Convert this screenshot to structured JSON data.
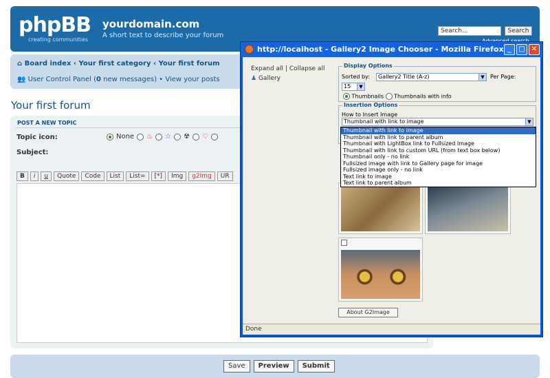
{
  "header": {
    "logo": "phpBB",
    "logo_tag": "creating   communities",
    "site_title": "yourdomain.com",
    "site_desc": "A short text to describe your forum",
    "search_placeholder": "Search…",
    "search_button": "Search",
    "advanced_search": "Advanced search"
  },
  "nav": {
    "board_index": "Board index",
    "category": "Your first category",
    "forum": "Your first forum",
    "ucp": "User Control Panel (",
    "ucp_count": "0",
    "ucp_rest": " new messages)",
    "view_posts": "View your posts"
  },
  "forum_title": "Your first forum",
  "post": {
    "heading": "POST A NEW TOPIC",
    "topic_icon_label": "Topic icon:",
    "none_label": "None",
    "subject_label": "Subject:",
    "toolbar": [
      "B",
      "i",
      "u",
      "Quote",
      "Code",
      "List",
      "List=",
      "[*]",
      "Img",
      "g2Img",
      "UR"
    ],
    "buttons": [
      "Save",
      "Preview",
      "Submit"
    ]
  },
  "firefox": {
    "title": "http://localhost - Gallery2 Image Chooser - Mozilla Firefox",
    "status": "Done",
    "expand_all": "Expand all",
    "collapse_all": "Collapse all",
    "gallery": "Gallery",
    "display_options": "Display Options",
    "sorted_by_label": "Sorted by:",
    "sorted_by_value": "Gallery2 Title (A-z)",
    "per_page_label": "Per Page:",
    "per_page_value": "15",
    "view_thumbnails": "Thumbnails",
    "view_thumbnails_info": "Thumbnails with info",
    "insertion_options": "Insertion Options",
    "how_to_insert": "How to Insert Image",
    "insert_value": "Thumbnail with link to image",
    "insert_options": [
      "Thumbnail with link to image",
      "Thumbnail with link to parent album",
      "Thumbnail with LightBox link to Fullsized Image",
      "Thumbnail with link to custom URL (from text box below)",
      "Thumbnail only - no link",
      "Fullsized image with link to Gallery page for image",
      "Fullsized image only - no link",
      "Text link to image",
      "Text link to parent album"
    ],
    "about_button": "About G2Image"
  }
}
